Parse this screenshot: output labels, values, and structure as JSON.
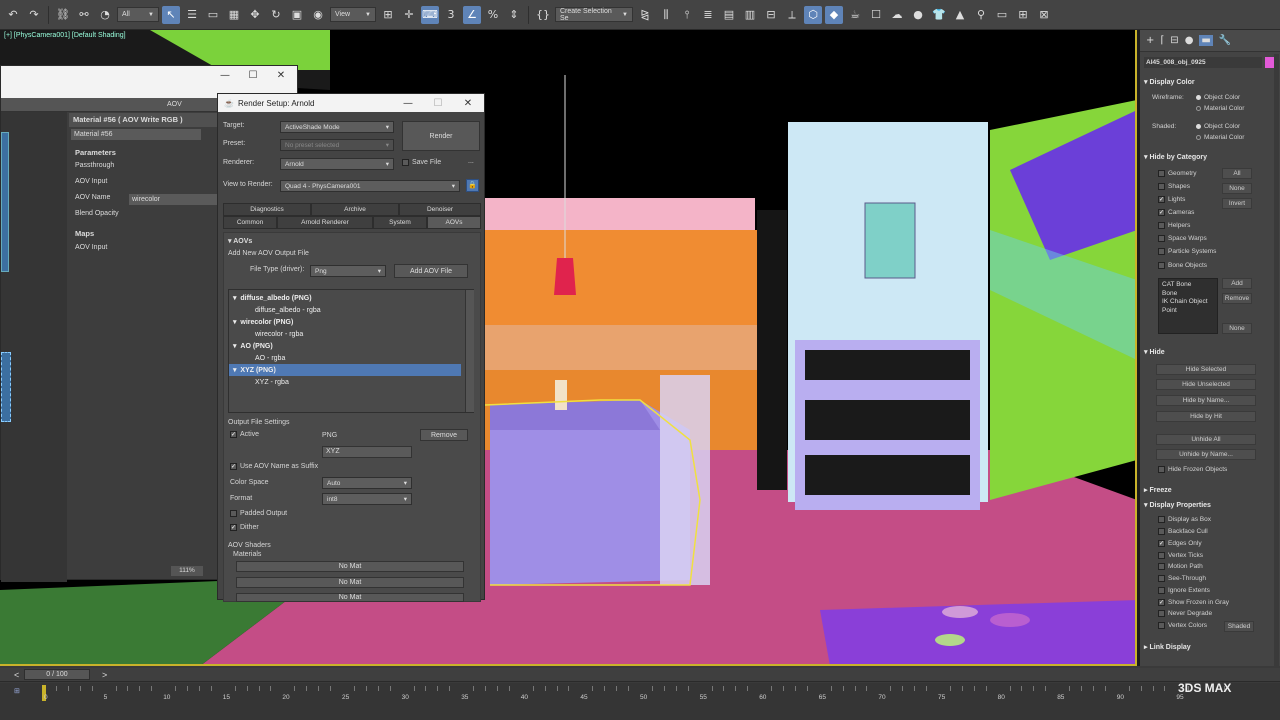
{
  "toolbar": {
    "filter_label": "All",
    "view_label": "View",
    "selection_set_placeholder": "Create Selection Se"
  },
  "viewport": {
    "label": "[+] [PhysCamera001] [Default Shading]"
  },
  "mat_window": {
    "aov_label": "AOV",
    "material_title": "Material #56  ( AOV Write RGB )",
    "material_name": "Material #56",
    "params_header": "Parameters",
    "passthrough_label": "Passthrough",
    "aov_input_label": "AOV Input",
    "aov_name_label": "AOV Name",
    "aov_name_value": "wirecolor",
    "blend_opacity_label": "Blend Opacity",
    "maps_header": "Maps",
    "maps_aov_input": "AOV Input",
    "zoom": "111%"
  },
  "render_setup": {
    "title": "Render Setup: Arnold",
    "target_label": "Target:",
    "target_value": "ActiveShade Mode",
    "preset_label": "Preset:",
    "preset_value": "No preset selected",
    "renderer_label": "Renderer:",
    "renderer_value": "Arnold",
    "save_file_label": "Save File",
    "render_button": "Render",
    "view_label": "View to Render:",
    "view_value": "Quad 4 - PhysCamera001",
    "tabs_row1": [
      "Diagnostics",
      "Archive",
      "Denoiser"
    ],
    "tabs_row2": [
      "Common",
      "Arnold Renderer",
      "System",
      "AOVs"
    ],
    "aovs_header": "AOVs",
    "add_new_label": "Add New AOV Output File",
    "file_type_label": "File Type (driver):",
    "file_type_value": "Png",
    "add_aov_button": "Add AOV File",
    "tree": [
      {
        "label": "diffuse_albedo (PNG)",
        "child": "diffuse_albedo - rgba",
        "selected": false
      },
      {
        "label": "wirecolor (PNG)",
        "child": "wirecolor - rgba",
        "selected": false
      },
      {
        "label": "AO (PNG)",
        "child": "AO - rgba",
        "selected": false
      },
      {
        "label": "XYZ (PNG)",
        "child": "XYZ - rgba",
        "selected": true
      }
    ],
    "output_settings_label": "Output File Settings",
    "active_label": "Active",
    "png_label": "PNG",
    "remove_button": "Remove",
    "name_value": "XYZ",
    "use_aov_label": "Use AOV Name as Suffix",
    "color_space_label": "Color Space",
    "color_space_value": "Auto",
    "format_label": "Format",
    "format_value": "int8",
    "padded_label": "Padded Output",
    "dither_label": "Dither",
    "shaders_label": "AOV Shaders",
    "materials_label": "Materials",
    "no_mat_1": "No Mat",
    "no_mat_2": "No Mat",
    "no_mat_3": "No Mat"
  },
  "command_panel": {
    "object_name": "AI45_008_obj_0925",
    "display_color": "Display Color",
    "wireframe_label": "Wireframe:",
    "shaded_label": "Shaded:",
    "object_color": "Object Color",
    "material_color": "Material Color",
    "hide_by_category": "Hide by Category",
    "categories": [
      "Geometry",
      "Shapes",
      "Lights",
      "Cameras",
      "Helpers",
      "Space Warps",
      "Particle Systems",
      "Bone Objects"
    ],
    "all_btn": "All",
    "none_btn": "None",
    "invert_btn": "Invert",
    "list_items": [
      "CAT Bone",
      "Bone",
      "IK Chain Object",
      "Point"
    ],
    "add_btn": "Add",
    "remove_btn": "Remove",
    "none_btn2": "None",
    "hide_header": "Hide",
    "hide_buttons": [
      "Hide Selected",
      "Hide Unselected",
      "Hide by Name...",
      "Hide by Hit",
      "Unhide All",
      "Unhide by Name..."
    ],
    "hide_frozen": "Hide Frozen Objects",
    "freeze_header": "Freeze",
    "display_props_header": "Display Properties",
    "display_props": [
      "Display as Box",
      "Backface Cull",
      "Edges Only",
      "Vertex Ticks",
      "Motion Path",
      "See-Through",
      "Ignore Extents",
      "Show Frozen in Gray",
      "Never Degrade",
      "Vertex Colors"
    ],
    "shaded_btn": "Shaded",
    "link_display": "Link Display"
  },
  "timeline": {
    "frame_counter": "0 / 100",
    "ticks": [
      "0",
      "5",
      "10",
      "15",
      "20",
      "25",
      "30",
      "35",
      "40",
      "45",
      "50",
      "55",
      "60",
      "65",
      "70",
      "75",
      "80",
      "85",
      "90",
      "95"
    ],
    "logo_text": "3DS MAX"
  },
  "colors": {
    "accent": "#5f84b8",
    "viewport_border": "#c9b32a"
  }
}
